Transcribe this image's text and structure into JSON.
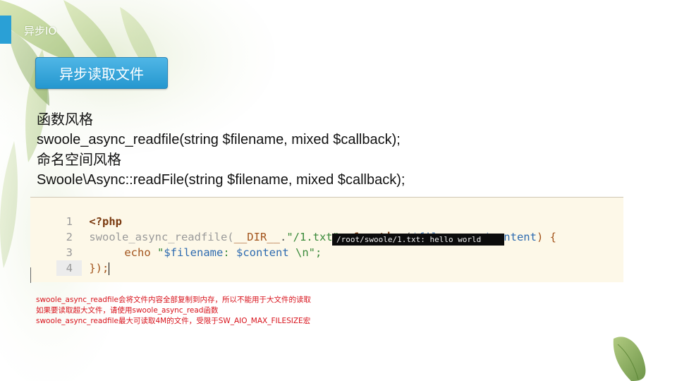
{
  "header": {
    "title": "异步IO"
  },
  "section": {
    "button_label": "异步读取文件"
  },
  "description": {
    "lines": [
      "函数风格",
      "swoole_async_readfile(string $filename, mixed $callback);",
      "命名空间风格",
      "Swoole\\Async::readFile(string $filename, mixed $callback);"
    ]
  },
  "code": {
    "line_numbers": [
      "1",
      "2",
      "3",
      "4"
    ],
    "line1": "<?php",
    "line2": {
      "fn": "swoole_async_readfile(",
      "dir": "__DIR__",
      "concat": ".",
      "str": "\"/1.txt\"",
      "sep": ", ",
      "kw": "function",
      "open": "(",
      "var1": "$filename",
      "comma": ", ",
      "var2": "$content",
      "close": ") {"
    },
    "line3": {
      "kw": "echo",
      "q1": " \"",
      "var1": "$filename",
      "mid": ": ",
      "var2": "$content",
      "rest": " \\n\";"
    },
    "line4": "});"
  },
  "terminal": {
    "output": "/root/swoole/1.txt: hello world"
  },
  "notes": [
    "swoole_async_readfile会将文件内容全部复制到内存，所以不能用于大文件的读取",
    "如果要读取超大文件，请使用swoole_async_read函数",
    "swoole_async_readfile最大可读取4M的文件，受限于SW_AIO_MAX_FILESIZE宏"
  ],
  "colors": {
    "accent": "#2aa0d6",
    "note_red": "#d8121b",
    "code_bg": "#fdf8e8"
  }
}
